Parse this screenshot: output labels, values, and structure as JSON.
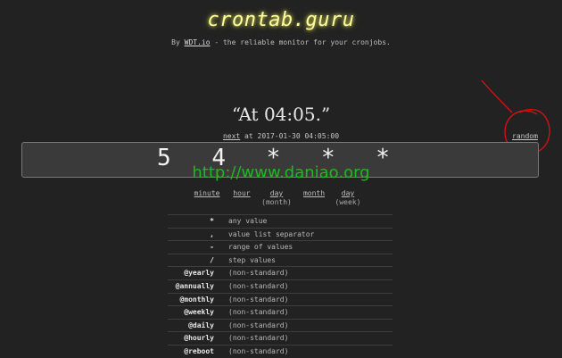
{
  "header": {
    "logo": "crontab.guru",
    "byline_prefix": "By ",
    "byline_link": "WDT.io",
    "byline_suffix": " - the reliable monitor for your cronjobs."
  },
  "result": {
    "human": "“At 04:05.”",
    "next_label": "next",
    "next_text": " at 2017-01-30 04:05:00",
    "random_label": "random"
  },
  "expression": {
    "value": "5 4 * * *"
  },
  "watermark": "http://www.daniao.org",
  "fields": [
    {
      "name": "minute",
      "sub": ""
    },
    {
      "name": "hour",
      "sub": ""
    },
    {
      "name": "day",
      "sub": "(month)"
    },
    {
      "name": "month",
      "sub": ""
    },
    {
      "name": "day",
      "sub": "(week)"
    }
  ],
  "reference": [
    {
      "symbol": "*",
      "description": "any value"
    },
    {
      "symbol": ",",
      "description": "value list separator"
    },
    {
      "symbol": "-",
      "description": "range of values"
    },
    {
      "symbol": "/",
      "description": "step values"
    },
    {
      "symbol": "@yearly",
      "description": "(non-standard)"
    },
    {
      "symbol": "@annually",
      "description": "(non-standard)"
    },
    {
      "symbol": "@monthly",
      "description": "(non-standard)"
    },
    {
      "symbol": "@weekly",
      "description": "(non-standard)"
    },
    {
      "symbol": "@daily",
      "description": "(non-standard)"
    },
    {
      "symbol": "@hourly",
      "description": "(non-standard)"
    },
    {
      "symbol": "@reboot",
      "description": "(non-standard)"
    }
  ],
  "colors": {
    "background": "#222222",
    "logo": "#ffff99",
    "watermark": "#1fb81f",
    "annotation": "#e01010"
  }
}
